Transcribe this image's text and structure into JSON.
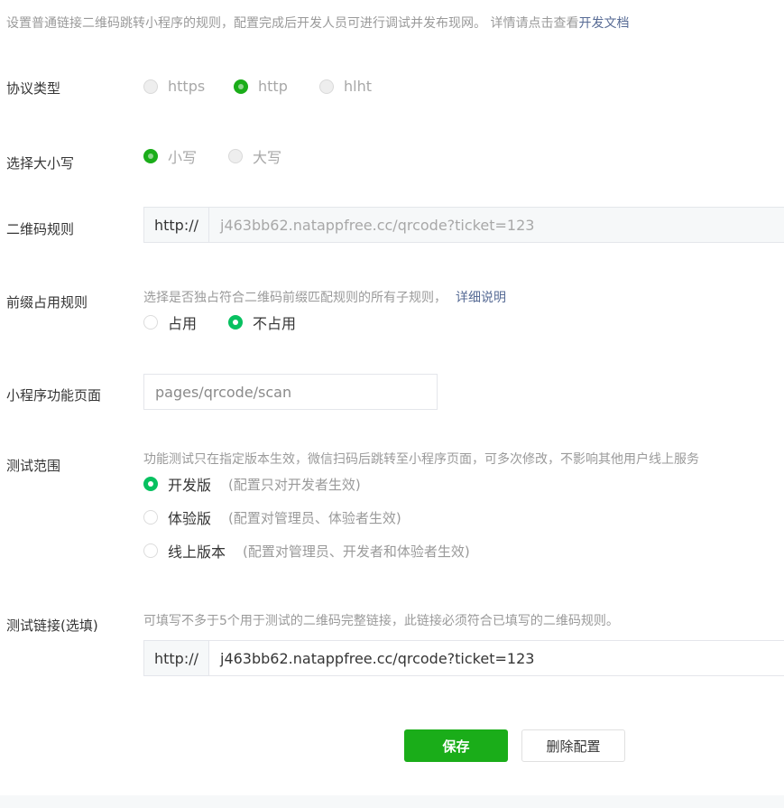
{
  "intro": {
    "text": "设置普通链接二维码跳转小程序的规则，配置完成后开发人员可进行调试并发布现网。 详情请点击查看",
    "link": "开发文档"
  },
  "protocol": {
    "label": "协议类型",
    "options": [
      "https",
      "http",
      "hlht"
    ],
    "selected": "http"
  },
  "case": {
    "label": "选择大小写",
    "options": [
      "小写",
      "大写"
    ],
    "selected": "小写"
  },
  "qrcode_rule": {
    "label": "二维码规则",
    "prefix": "http://",
    "value": "j463bb62.natappfree.cc/qrcode?ticket=123"
  },
  "prefix_rule": {
    "label": "前缀占用规则",
    "hint": "选择是否独占符合二维码前缀匹配规则的所有子规则，",
    "hint_link": "详细说明",
    "options": [
      "占用",
      "不占用"
    ],
    "selected": "不占用"
  },
  "page": {
    "label": "小程序功能页面",
    "value": "pages/qrcode/scan"
  },
  "test_scope": {
    "label": "测试范围",
    "hint": "功能测试只在指定版本生效，微信扫码后跳转至小程序页面，可多次修改，不影响其他用户线上服务",
    "options": [
      {
        "label": "开发版",
        "desc": "(配置只对开发者生效)"
      },
      {
        "label": "体验版",
        "desc": "(配置对管理员、体验者生效)"
      },
      {
        "label": "线上版本",
        "desc": "(配置对管理员、开发者和体验者生效)"
      }
    ],
    "selected": "开发版"
  },
  "test_link": {
    "label": "测试链接(选填)",
    "hint": "可填写不多于5个用于测试的二维码完整链接，此链接必须符合已填写的二维码规则。",
    "prefix": "http://",
    "value": "j463bb62.natappfree.cc/qrcode?ticket=123"
  },
  "buttons": {
    "save": "保存",
    "delete": "删除配置"
  },
  "colors": {
    "primary": "#1aad19",
    "radio_active": "#07c160",
    "link": "#576b95"
  }
}
